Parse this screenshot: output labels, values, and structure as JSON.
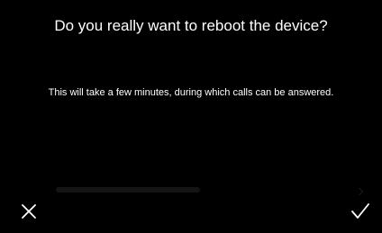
{
  "dialog": {
    "title": "Do you really want to reboot the device?",
    "message": "This will take a few minutes, during which calls can be answered.",
    "cancel_icon": "close-icon",
    "confirm_icon": "checkmark-icon"
  },
  "colors": {
    "background": "#000000",
    "text": "#ffffff",
    "icon": "#ffffff"
  }
}
